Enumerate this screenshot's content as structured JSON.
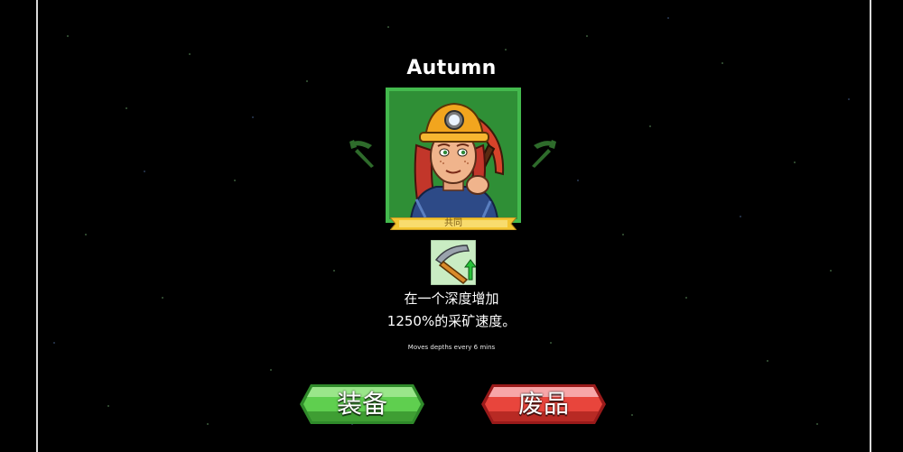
{
  "character": {
    "name": "Autumn",
    "rarity": "共同"
  },
  "perk": {
    "icon": "pickaxe-upgrade-icon",
    "description_line1": "在一个深度增加",
    "description_line2": "1250%的采矿速度。",
    "note": "Moves depths every 6 mins"
  },
  "navigation": {
    "prev_icon": "pickaxe-left-arrow-icon",
    "next_icon": "pickaxe-right-arrow-icon"
  },
  "actions": {
    "equip_label": "装备",
    "scrap_label": "废品"
  },
  "colors": {
    "background": "#000000",
    "portrait_border": "#43b94d",
    "equip_button": "#5fcf4f",
    "scrap_button": "#e8453c",
    "rarity_ribbon": "#f3c531"
  }
}
